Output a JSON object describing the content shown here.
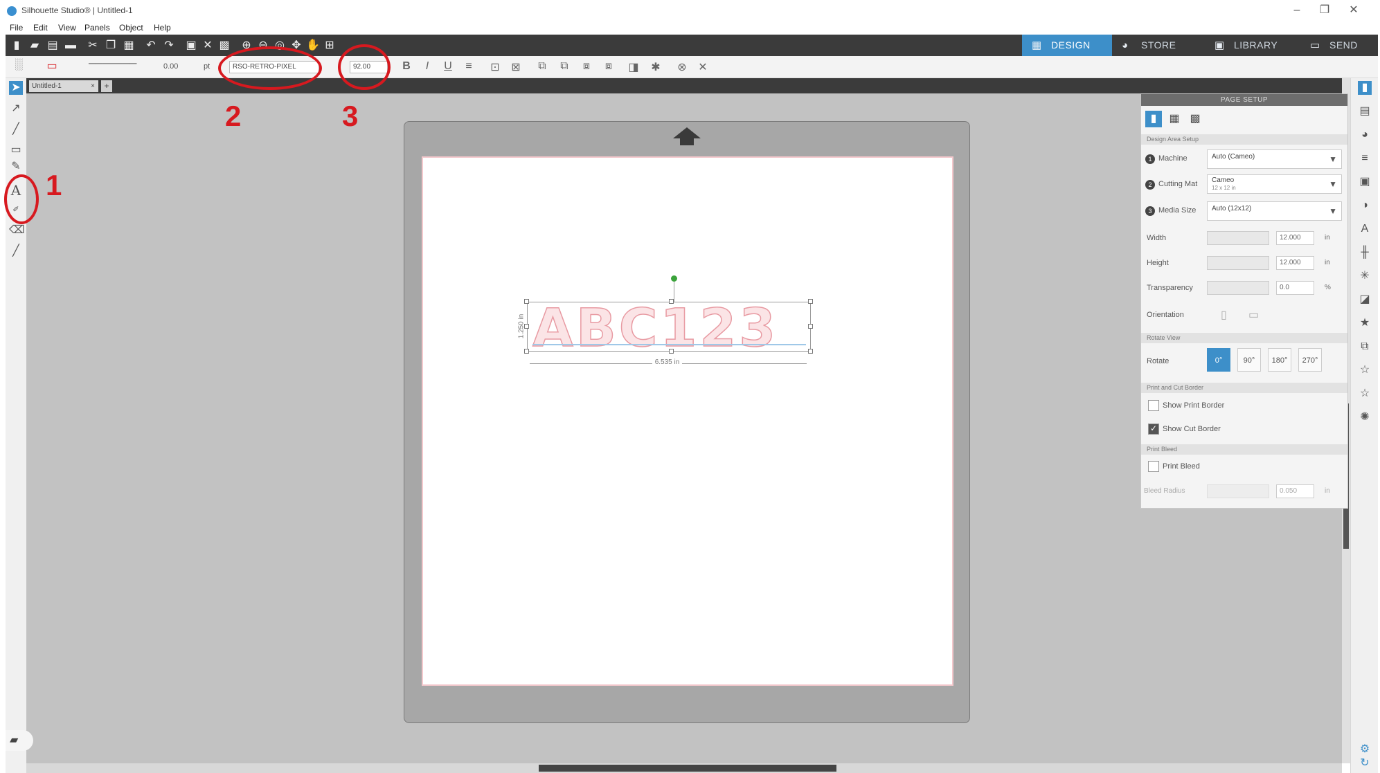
{
  "window": {
    "title": "Silhouette Studio® | Untitled-1",
    "controls": {
      "minimize": "–",
      "restore": "❐",
      "close": "✕"
    }
  },
  "menu": {
    "items": [
      "File",
      "Edit",
      "View",
      "Panels",
      "Object",
      "Help"
    ]
  },
  "nav_tabs": [
    {
      "label": "DESIGN",
      "icon": "grid-icon",
      "glyph": "▦"
    },
    {
      "label": "STORE",
      "icon": "store-icon",
      "glyph": "◕"
    },
    {
      "label": "LIBRARY",
      "icon": "library-icon",
      "glyph": "▣"
    },
    {
      "label": "SEND",
      "icon": "send-icon",
      "glyph": "▭"
    }
  ],
  "secondary_toolbar": {
    "line_width": "0.00",
    "line_unit": "pt",
    "font_name": "RSO-RETRO-PIXEL",
    "font_size": "92.00"
  },
  "document": {
    "tab_label": "Untitled-1",
    "close_glyph": "×",
    "add_glyph": "+"
  },
  "canvas": {
    "text_object": "ABC123",
    "width_label": "6.535 in",
    "height_label": "1.250 in"
  },
  "annotations": {
    "n1": "1",
    "n2": "2",
    "n3": "3",
    "color": "#d7191f"
  },
  "page_setup": {
    "title": "PAGE SETUP",
    "section_design_area": "Design Area Setup",
    "machine_label": "Machine",
    "machine_value": "Auto (Cameo)",
    "mat_label": "Cutting Mat",
    "mat_value": "Cameo",
    "mat_sub": "12 x 12 in",
    "media_label": "Media Size",
    "media_value": "Auto (12x12)",
    "width_label": "Width",
    "width_value": "12.000",
    "height_label": "Height",
    "height_value": "12.000",
    "transparency_label": "Transparency",
    "transparency_value": "0.0",
    "unit_in": "in",
    "unit_pct": "%",
    "orientation_label": "Orientation",
    "section_rotate": "Rotate View",
    "rotate_label": "Rotate",
    "rotate_options": [
      "0°",
      "90°",
      "180°",
      "270°"
    ],
    "section_print_cut": "Print and Cut Border",
    "show_print_border": "Show Print Border",
    "show_cut_border": "Show Cut Border",
    "section_bleed": "Print Bleed",
    "print_bleed": "Print Bleed",
    "bleed_radius_label": "Bleed Radius",
    "bleed_radius_value": "0.050"
  },
  "colors": {
    "toolbar_dark": "#3b3b3b",
    "accent_blue": "#3d8fc9",
    "canvas_bg": "#c2c2c2",
    "mat_gray": "#a7a7a7",
    "text_pink": "#e89aa2"
  }
}
